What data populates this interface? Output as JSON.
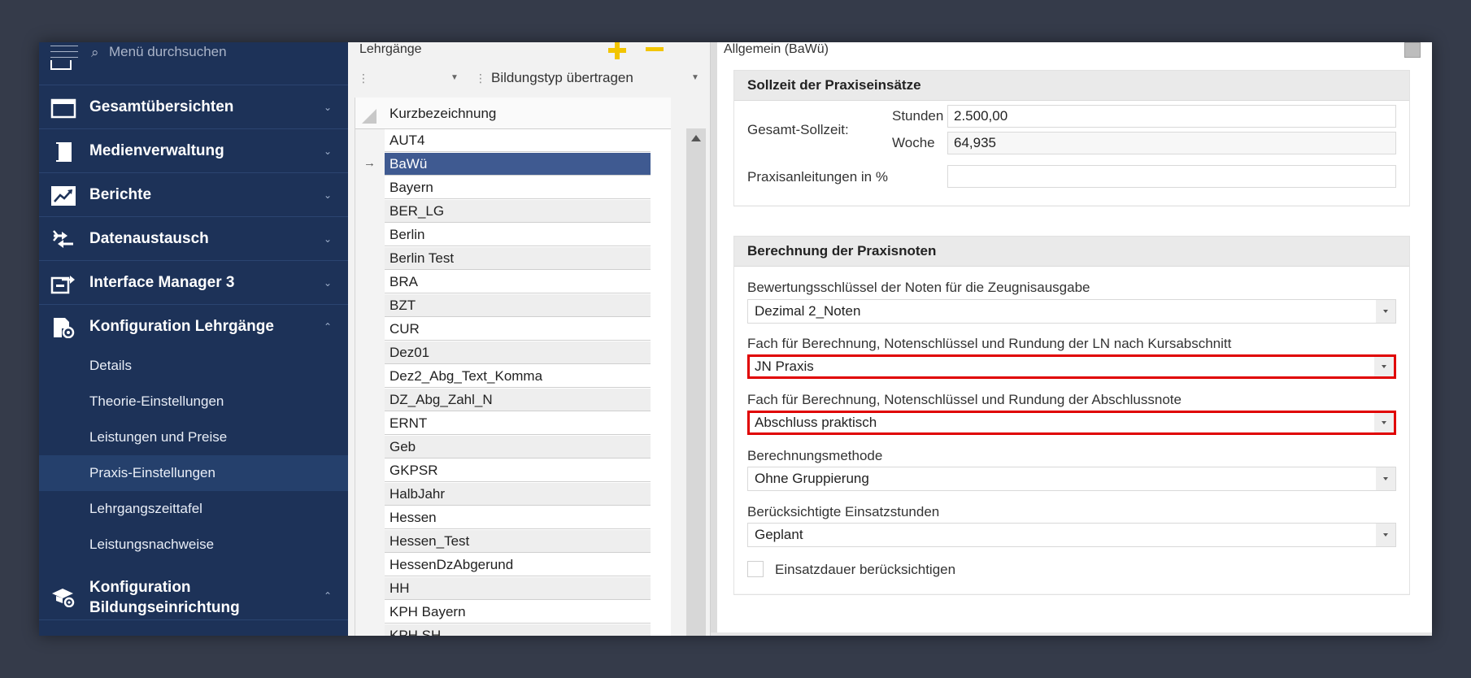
{
  "colors": {
    "sidebar_bg": "#1d3258",
    "active_row": "#3f5a91",
    "highlight_border": "#e00000",
    "accent_yellow": "#f2c500"
  },
  "sidebar": {
    "search": {
      "placeholder": "Menü durchsuchen",
      "icon": "search-icon"
    },
    "items": [
      {
        "label": "Gesamtübersichten",
        "icon": "window-icon"
      },
      {
        "label": "Medienverwaltung",
        "icon": "book-icon"
      },
      {
        "label": "Berichte",
        "icon": "chart-trend-icon"
      },
      {
        "label": "Datenaustausch",
        "icon": "exchange-arrows-icon"
      },
      {
        "label": "Interface Manager 3",
        "icon": "export-icon"
      },
      {
        "label": "Konfiguration Lehrgänge",
        "icon": "document-gear-icon"
      }
    ],
    "subitems": [
      {
        "label": "Details"
      },
      {
        "label": "Theorie-Einstellungen"
      },
      {
        "label": "Leistungen und Preise"
      },
      {
        "label": "Praxis-Einstellungen"
      },
      {
        "label": "Lehrgangszeittafel"
      },
      {
        "label": "Leistungsnachweise"
      }
    ],
    "bottom_item": {
      "line1": "Konfiguration",
      "line2": "Bildungseinrichtung",
      "icon": "graduation-gear-icon"
    }
  },
  "middle": {
    "title": "Lehrgänge",
    "toolbar": {
      "transfer_label": "Bildungstyp übertragen"
    },
    "grid": {
      "header": "Kurzbezeichnung",
      "rows": [
        "AUT4",
        "BaWü",
        "Bayern",
        "BER_LG",
        "Berlin",
        "Berlin Test",
        "BRA",
        "BZT",
        "CUR",
        "Dez01",
        "Dez2_Abg_Text_Komma",
        "DZ_Abg_Zahl_N",
        "ERNT",
        "Geb",
        "GKPSR",
        "HalbJahr",
        "Hessen",
        "Hessen_Test",
        "HessenDzAbgerund",
        "HH",
        "KPH Bayern",
        "KPH SH"
      ],
      "active_row": 1
    }
  },
  "right": {
    "title": "Allgemein (BaWü)",
    "group1": {
      "title": "Sollzeit der Praxiseinsätze",
      "gesamt_label": "Gesamt-Sollzeit:",
      "stunden_label": "Stunden",
      "stunden_value": "2.500,00",
      "woche_label": "Woche",
      "woche_value": "64,935",
      "praxis_label": "Praxisanleitungen in %",
      "praxis_value": ""
    },
    "group2": {
      "title": "Berechnung der Praxisnoten",
      "fields": [
        {
          "label": "Bewertungsschlüssel der Noten für die Zeugnisausgabe",
          "value": "Dezimal 2_Noten",
          "highlighted": false
        },
        {
          "label": "Fach für Berechnung, Notenschlüssel und Rundung der LN nach Kursabschnitt",
          "value": "JN Praxis",
          "highlighted": true
        },
        {
          "label": "Fach für Berechnung, Notenschlüssel und Rundung der Abschlussnote",
          "value": "Abschluss praktisch",
          "highlighted": true
        },
        {
          "label": "Berechnungsmethode",
          "value": "Ohne Gruppierung",
          "highlighted": false
        },
        {
          "label": "Berücksichtigte Einsatzstunden",
          "value": "Geplant",
          "highlighted": false
        }
      ],
      "checkbox_label": "Einsatzdauer berücksichtigen",
      "checkbox_checked": false
    }
  }
}
